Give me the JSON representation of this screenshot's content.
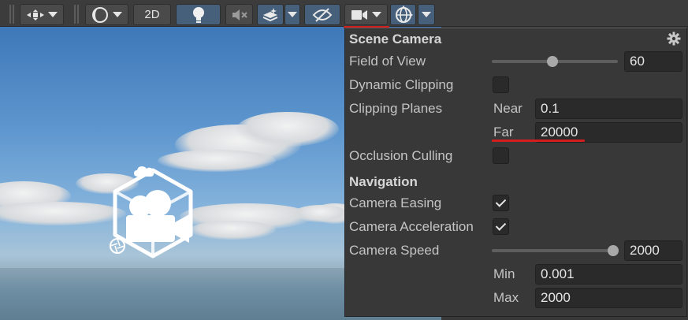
{
  "toolbar": {
    "view_2d_label": "2D",
    "buttons": [
      {
        "name": "transform-tool-button",
        "icon": "move-gizmo-icon"
      },
      {
        "name": "shading-mode-button",
        "icon": "shading-sphere-icon"
      },
      {
        "name": "2d-toggle-button",
        "icon": "2d-label"
      },
      {
        "name": "lighting-toggle-button",
        "icon": "lightbulb-icon"
      },
      {
        "name": "audio-toggle-button",
        "icon": "muted-speaker-icon"
      },
      {
        "name": "effects-toggle-button",
        "icon": "effects-stack-icon"
      },
      {
        "name": "visibility-toggle-button",
        "icon": "eye-slash-icon"
      },
      {
        "name": "camera-settings-button",
        "icon": "video-camera-icon"
      },
      {
        "name": "gizmos-toggle-button",
        "icon": "globe-gizmo-icon"
      }
    ]
  },
  "panel": {
    "title": "Scene Camera",
    "field_of_view": {
      "label": "Field of View",
      "value": "60",
      "slider_fraction": 0.48
    },
    "dynamic_clipping": {
      "label": "Dynamic Clipping",
      "checked": false
    },
    "clipping_planes": {
      "label": "Clipping Planes",
      "near_label": "Near",
      "near_value": "0.1",
      "far_label": "Far",
      "far_value": "20000"
    },
    "occlusion_culling": {
      "label": "Occlusion Culling",
      "checked": false
    },
    "navigation_heading": "Navigation",
    "camera_easing": {
      "label": "Camera Easing",
      "checked": true
    },
    "camera_acceleration": {
      "label": "Camera Acceleration",
      "checked": true
    },
    "camera_speed": {
      "label": "Camera Speed",
      "value": "2000",
      "slider_fraction": 1.0,
      "min_label": "Min",
      "min_value": "0.001",
      "max_label": "Max",
      "max_value": "2000"
    }
  },
  "colors": {
    "highlight_underline": "#d21e1e",
    "toggle_active": "#46607c",
    "panel_bg": "#383838"
  }
}
